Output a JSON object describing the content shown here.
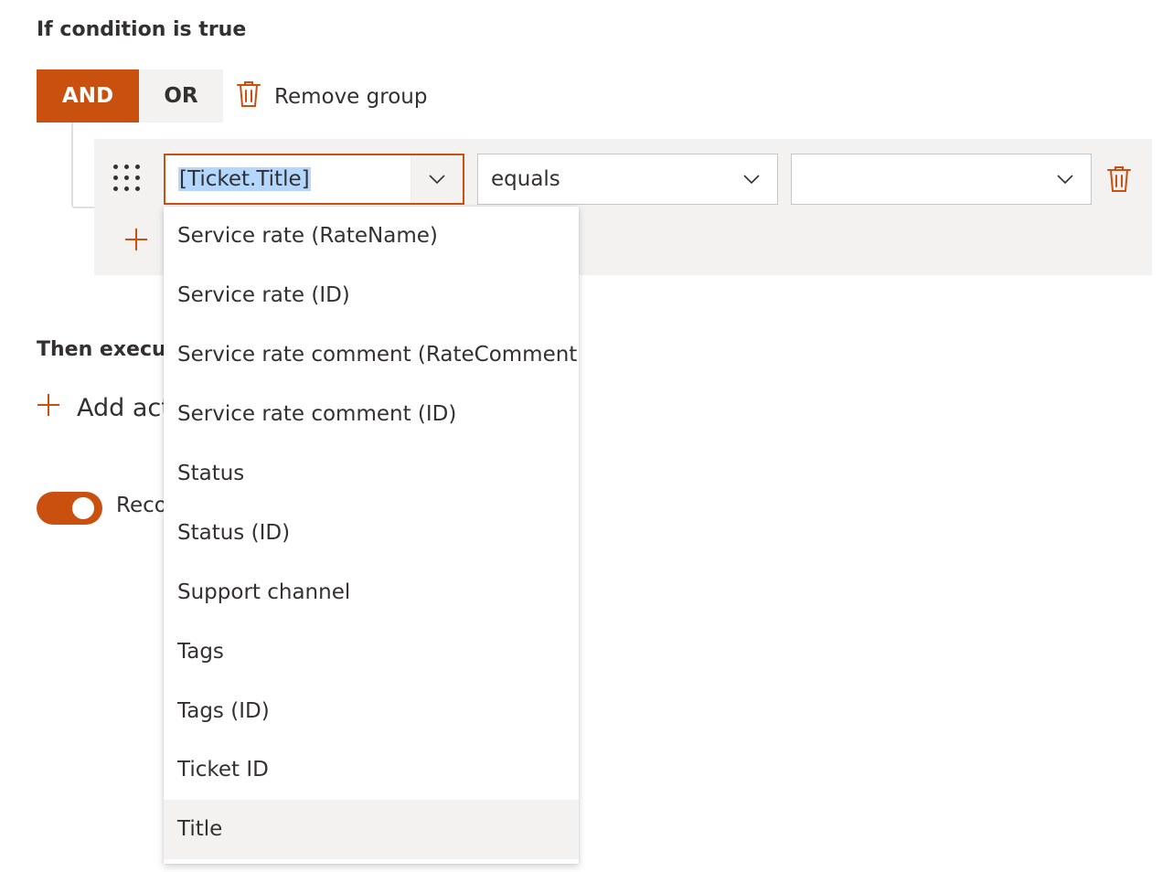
{
  "condition": {
    "title": "If condition is true",
    "and_label": "AND",
    "or_label": "OR",
    "remove_group_label": "Remove group",
    "field_value": "[Ticket.Title]",
    "operator_value": "equals",
    "value_value": ""
  },
  "actions": {
    "title": "Then execut",
    "add_action_label": "Add act"
  },
  "toggle": {
    "label": "Reco",
    "on": true
  },
  "dropdown": {
    "options": [
      "Service rate (RateName)",
      "Service rate (ID)",
      "Service rate comment (RateComment)",
      "Service rate comment (ID)",
      "Status",
      "Status (ID)",
      "Support channel",
      "Tags",
      "Tags (ID)",
      "Ticket ID",
      "Title"
    ],
    "hovered_option": "Title"
  },
  "colors": {
    "accent": "#ca5010",
    "neutral_bg": "#f3f2f1",
    "text": "#323130",
    "selection": "#b3d7ff"
  },
  "icons": {
    "remove_group": "trash-icon",
    "drag": "gripper-icon",
    "row_delete": "trash-icon",
    "add_condition": "plus-icon",
    "add_action": "plus-icon",
    "combo": "chevron-down-icon"
  }
}
